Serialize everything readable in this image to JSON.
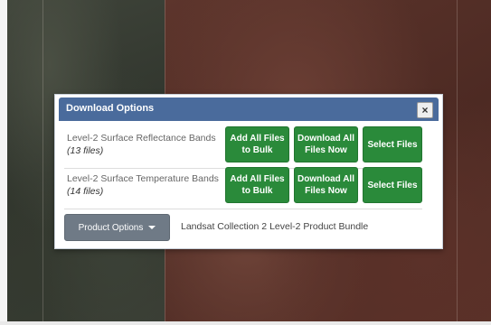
{
  "modal": {
    "title": "Download Options",
    "close_label": "×"
  },
  "bands": [
    {
      "name": "Level-2 Surface Reflectance Bands",
      "count": "(13 files)",
      "add_bulk": "Add All Files to Bulk",
      "download_now": "Download All Files Now",
      "select_files": "Select Files"
    },
    {
      "name": "Level-2 Surface Temperature Bands",
      "count": "(14 files)",
      "add_bulk": "Add All Files to Bulk",
      "download_now": "Download All Files Now",
      "select_files": "Select Files"
    }
  ],
  "product": {
    "button_label": "Product Options",
    "bundle_name": "Landsat Collection 2 Level-2 Product Bundle"
  },
  "colors": {
    "header": "#4a6b9c",
    "action_green": "#2a8a3a",
    "product_button": "#6f7a86"
  },
  "icons": {
    "close": "close-icon",
    "dropdown": "chevron-down-icon"
  }
}
